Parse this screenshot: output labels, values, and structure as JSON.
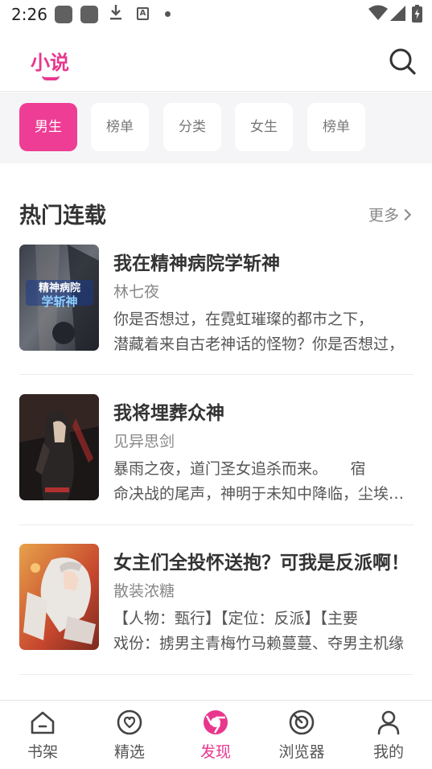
{
  "status_bar": {
    "time": "2:26",
    "a_badge": "A"
  },
  "header": {
    "title": "小说"
  },
  "categories": [
    {
      "label": "男生",
      "active": true
    },
    {
      "label": "榜单",
      "active": false
    },
    {
      "label": "分类",
      "active": false
    },
    {
      "label": "女生",
      "active": false
    },
    {
      "label": "榜单",
      "active": false
    }
  ],
  "section": {
    "title": "热门连载",
    "more": "更多"
  },
  "books": [
    {
      "title": "我在精神病院学斩神",
      "author": "林七夜",
      "desc_line1": "你是否想过，在霓虹璀璨的都市之下，",
      "desc_line2": "潜藏着来自古老神话的怪物？你是否想过，",
      "cover_text": "精神病院 学斩神"
    },
    {
      "title": "我将埋葬众神",
      "author": "见异思剑",
      "desc_line1": "暴雨之夜，道门圣女追杀而来。　　宿",
      "desc_line2": "命决战的尾声，神明于未知中降临，尘埃落定。",
      "cover_text": ""
    },
    {
      "title": "女主们全投怀送抱？可我是反派啊！",
      "author": "散装浓糖",
      "desc_line1": "【人物：甄行】【定位：反派】【主要",
      "desc_line2": "戏份：掳男主青梅竹马赖蔓蔓、夺男主机缘",
      "cover_text": ""
    }
  ],
  "bottom_nav": [
    {
      "label": "书架",
      "icon": "home-icon",
      "active": false
    },
    {
      "label": "精选",
      "icon": "heart-circle-icon",
      "active": false
    },
    {
      "label": "发现",
      "icon": "discover-icon",
      "active": true
    },
    {
      "label": "浏览器",
      "icon": "browser-icon",
      "active": false
    },
    {
      "label": "我的",
      "icon": "person-icon",
      "active": false
    }
  ],
  "colors": {
    "accent": "#e8378d",
    "chip_active": "#ee3d94",
    "chip_bg": "#ffffff",
    "cat_bar_bg": "#f5f5f7"
  }
}
